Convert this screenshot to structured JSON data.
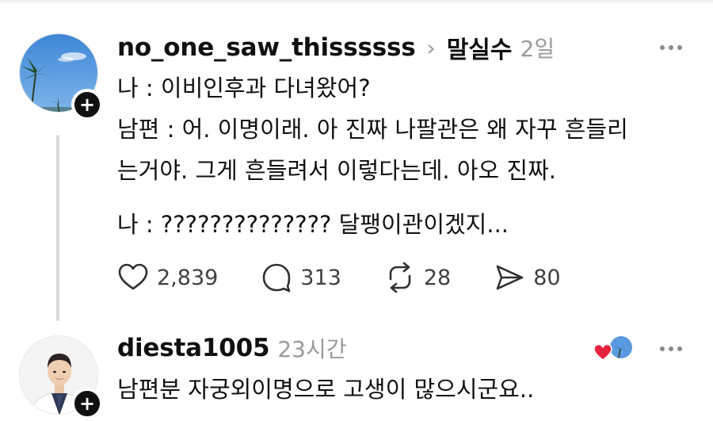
{
  "post": {
    "username": "no_one_saw_thissssss",
    "chevron": "›",
    "reply_to": "말실수",
    "time": "2일",
    "follow_symbol": "+",
    "lines": [
      "나 : 이비인후과 다녀왔어?",
      "남편 : 어. 이명이래. 아 진짜 나팔관은 왜 자꾸 흔들리",
      "는거야. 그게 흔들려서 이렇다는데. 아오 진짜.",
      "나 : ?????????????? 달팽이관이겠지..."
    ],
    "actions": {
      "likes": "2,839",
      "comments": "313",
      "reposts": "28",
      "shares": "80"
    }
  },
  "reply": {
    "username": "diesta1005",
    "time": "23시간",
    "follow_symbol": "+",
    "text": "남편분 자궁외이명으로 고생이 많으시군요.."
  },
  "icons": {
    "like": "heart-outline-icon",
    "comment": "speech-bubble-icon",
    "repost": "repost-arrows-icon",
    "share": "send-icon",
    "more": "more-dots-icon",
    "liked_by_author": "red-heart-icon"
  },
  "colors": {
    "text": "#101010",
    "muted": "#9a9a9a",
    "heart_red": "#e8213f",
    "thread_line": "#d9d9d9"
  }
}
